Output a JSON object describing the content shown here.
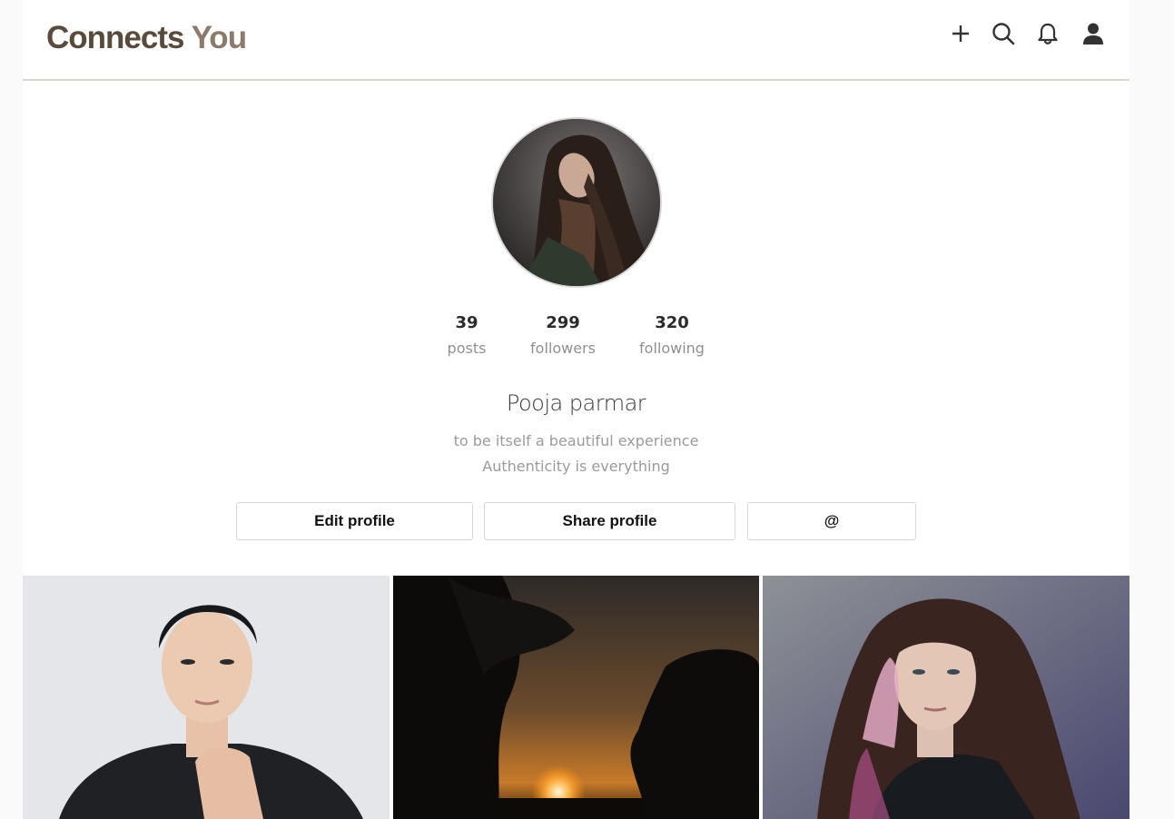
{
  "header": {
    "brand_part1": "Connects",
    "brand_part2": "You",
    "icons": [
      "add-icon",
      "search-icon",
      "bell-icon",
      "user-icon"
    ]
  },
  "profile": {
    "stats": [
      {
        "value": "39",
        "label": "posts"
      },
      {
        "value": "299",
        "label": "followers"
      },
      {
        "value": "320",
        "label": "following"
      }
    ],
    "name": "Pooja parmar",
    "bio_line1": "to be itself a beautiful experience",
    "bio_line2": "Authenticity is everything"
  },
  "actions": {
    "edit_label": "Edit profile",
    "share_label": "Share profile",
    "mention_label": "@"
  },
  "colors": {
    "brand_dark": "#5a4a3c",
    "brand_light": "#8c7b6b",
    "divider": "#d9d6cc"
  }
}
